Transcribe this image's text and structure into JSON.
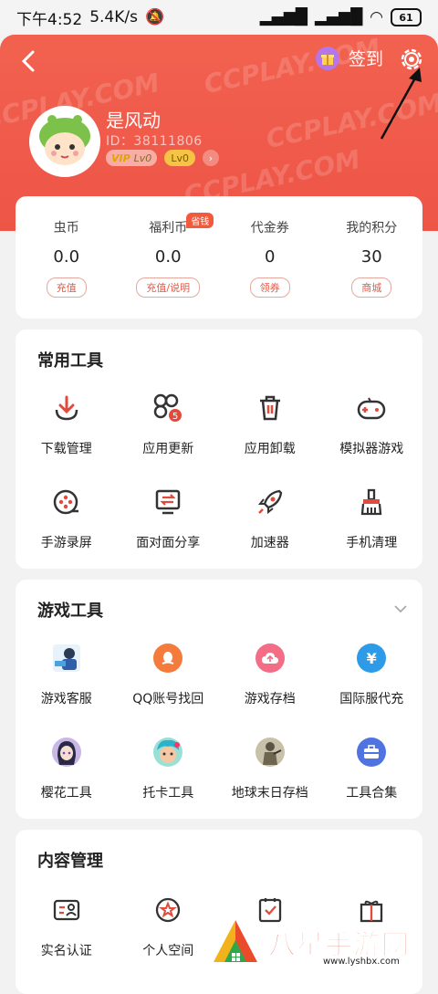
{
  "status": {
    "time": "下午4:52",
    "speed": "5.4K/s",
    "battery": "61"
  },
  "header": {
    "signin_label": "签到",
    "username": "是风动",
    "user_id": "ID：38111806",
    "vip_label": "VIP",
    "vip_level": "Lv0",
    "level": "Lv0",
    "watermarks": [
      "CCPLAY.COM",
      "CCPLAY.COM",
      "CCPLAY.COM",
      "CCPLAY.COM"
    ]
  },
  "wallet": {
    "items": [
      {
        "label": "虫币",
        "value": "0.0",
        "button": "充值"
      },
      {
        "label": "福利币",
        "value": "0.0",
        "button": "充值/说明",
        "tag": "省钱"
      },
      {
        "label": "代金券",
        "value": "0",
        "button": "领券"
      },
      {
        "label": "我的积分",
        "value": "30",
        "button": "商城"
      }
    ]
  },
  "common_tools": {
    "title": "常用工具",
    "items": [
      {
        "label": "下载管理",
        "icon": "download-icon"
      },
      {
        "label": "应用更新",
        "icon": "app-update-icon",
        "badge": "5"
      },
      {
        "label": "应用卸载",
        "icon": "trash-icon"
      },
      {
        "label": "模拟器游戏",
        "icon": "gamepad-icon"
      },
      {
        "label": "手游录屏",
        "icon": "screen-record-icon"
      },
      {
        "label": "面对面分享",
        "icon": "share-icon"
      },
      {
        "label": "加速器",
        "icon": "rocket-icon"
      },
      {
        "label": "手机清理",
        "icon": "broom-icon"
      }
    ]
  },
  "game_tools": {
    "title": "游戏工具",
    "items": [
      {
        "label": "游戏客服",
        "icon": "customer-service-icon"
      },
      {
        "label": "QQ账号找回",
        "icon": "qq-icon"
      },
      {
        "label": "游戏存档",
        "icon": "cloud-save-icon"
      },
      {
        "label": "国际服代充",
        "icon": "yen-icon"
      },
      {
        "label": "樱花工具",
        "icon": "sakura-avatar-icon"
      },
      {
        "label": "托卡工具",
        "icon": "toca-avatar-icon"
      },
      {
        "label": "地球末日存档",
        "icon": "doomsday-avatar-icon"
      },
      {
        "label": "工具合集",
        "icon": "toolbox-icon"
      }
    ]
  },
  "content_manage": {
    "title": "内容管理",
    "items": [
      {
        "label": "实名认证",
        "icon": "id-card-icon"
      },
      {
        "label": "个人空间",
        "icon": "star-icon"
      },
      {
        "label": "",
        "icon": "task-icon"
      },
      {
        "label": "",
        "icon": "gift-box-icon"
      }
    ]
  },
  "watermark": {
    "text": "八星手游网",
    "url": "www.lyshbx.com"
  },
  "colors": {
    "accent": "#ee5547",
    "icon": "#e24a3b"
  }
}
